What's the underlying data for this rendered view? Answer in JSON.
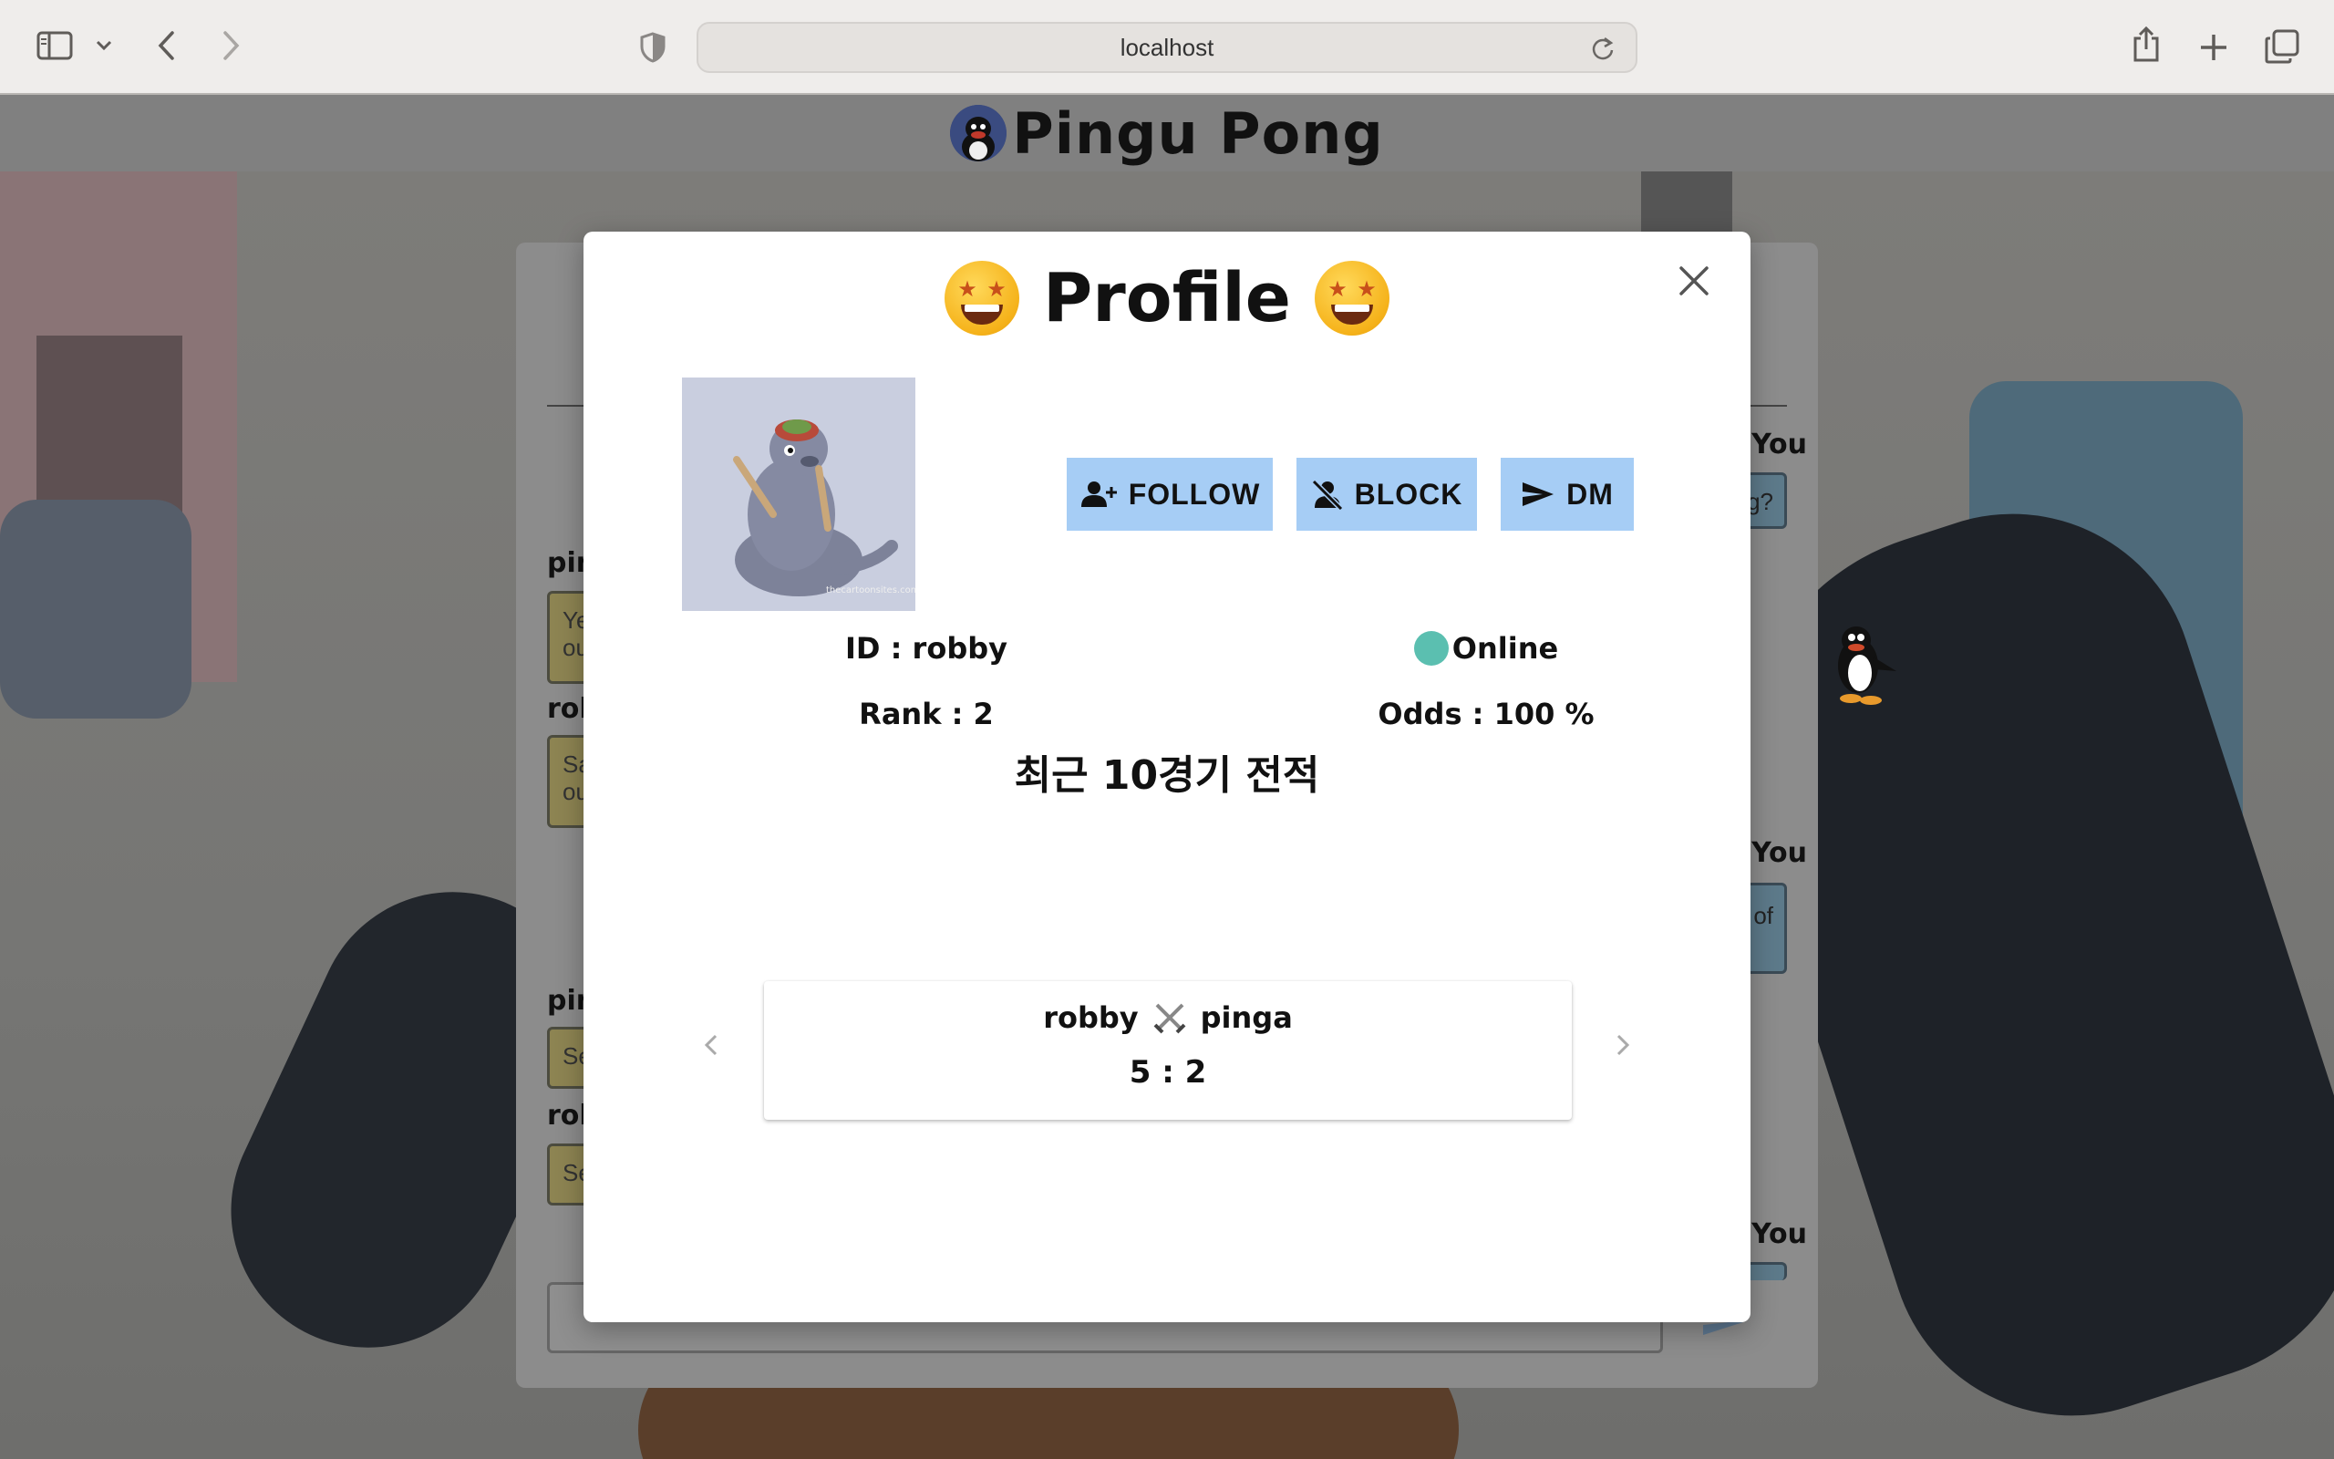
{
  "browser": {
    "url": "localhost",
    "icons": [
      "sidebar-icon",
      "chevron-down-icon",
      "back-icon",
      "forward-icon",
      "shield-icon",
      "reload-icon",
      "share-icon",
      "new-tab-icon",
      "tabs-overview-icon"
    ]
  },
  "app": {
    "title": "Pingu Pong"
  },
  "chat": {
    "names": {
      "pinga_1": "pin",
      "robby_1": "rol",
      "pinga_2": "pin",
      "robby_2": "rol",
      "you_1": "You",
      "you_2": "You",
      "you_3": "You"
    },
    "bubbles": {
      "left_1": "Ye\nou",
      "left_2": "Sa\nou",
      "left_3": "Se",
      "left_4": "Se",
      "right_1": "g?",
      "right_2": "of"
    }
  },
  "modal": {
    "title": "Profile",
    "buttons": {
      "follow": "FOLLOW",
      "block": "BLOCK",
      "dm": "DM"
    },
    "profile": {
      "id_text": "ID : robby",
      "status": "Online",
      "rank_text": "Rank : 2",
      "odds_text": "Odds : 100 %"
    },
    "history_title": "최근 10경기 전적",
    "match": {
      "player1": "robby",
      "player2": "pinga",
      "score": "5 : 2"
    },
    "avatar_watermark": "thecartoonsites.com"
  },
  "colors": {
    "button_bg": "#a6cdf5",
    "online_dot": "#5bbfb0",
    "header_bg": "#808080"
  }
}
